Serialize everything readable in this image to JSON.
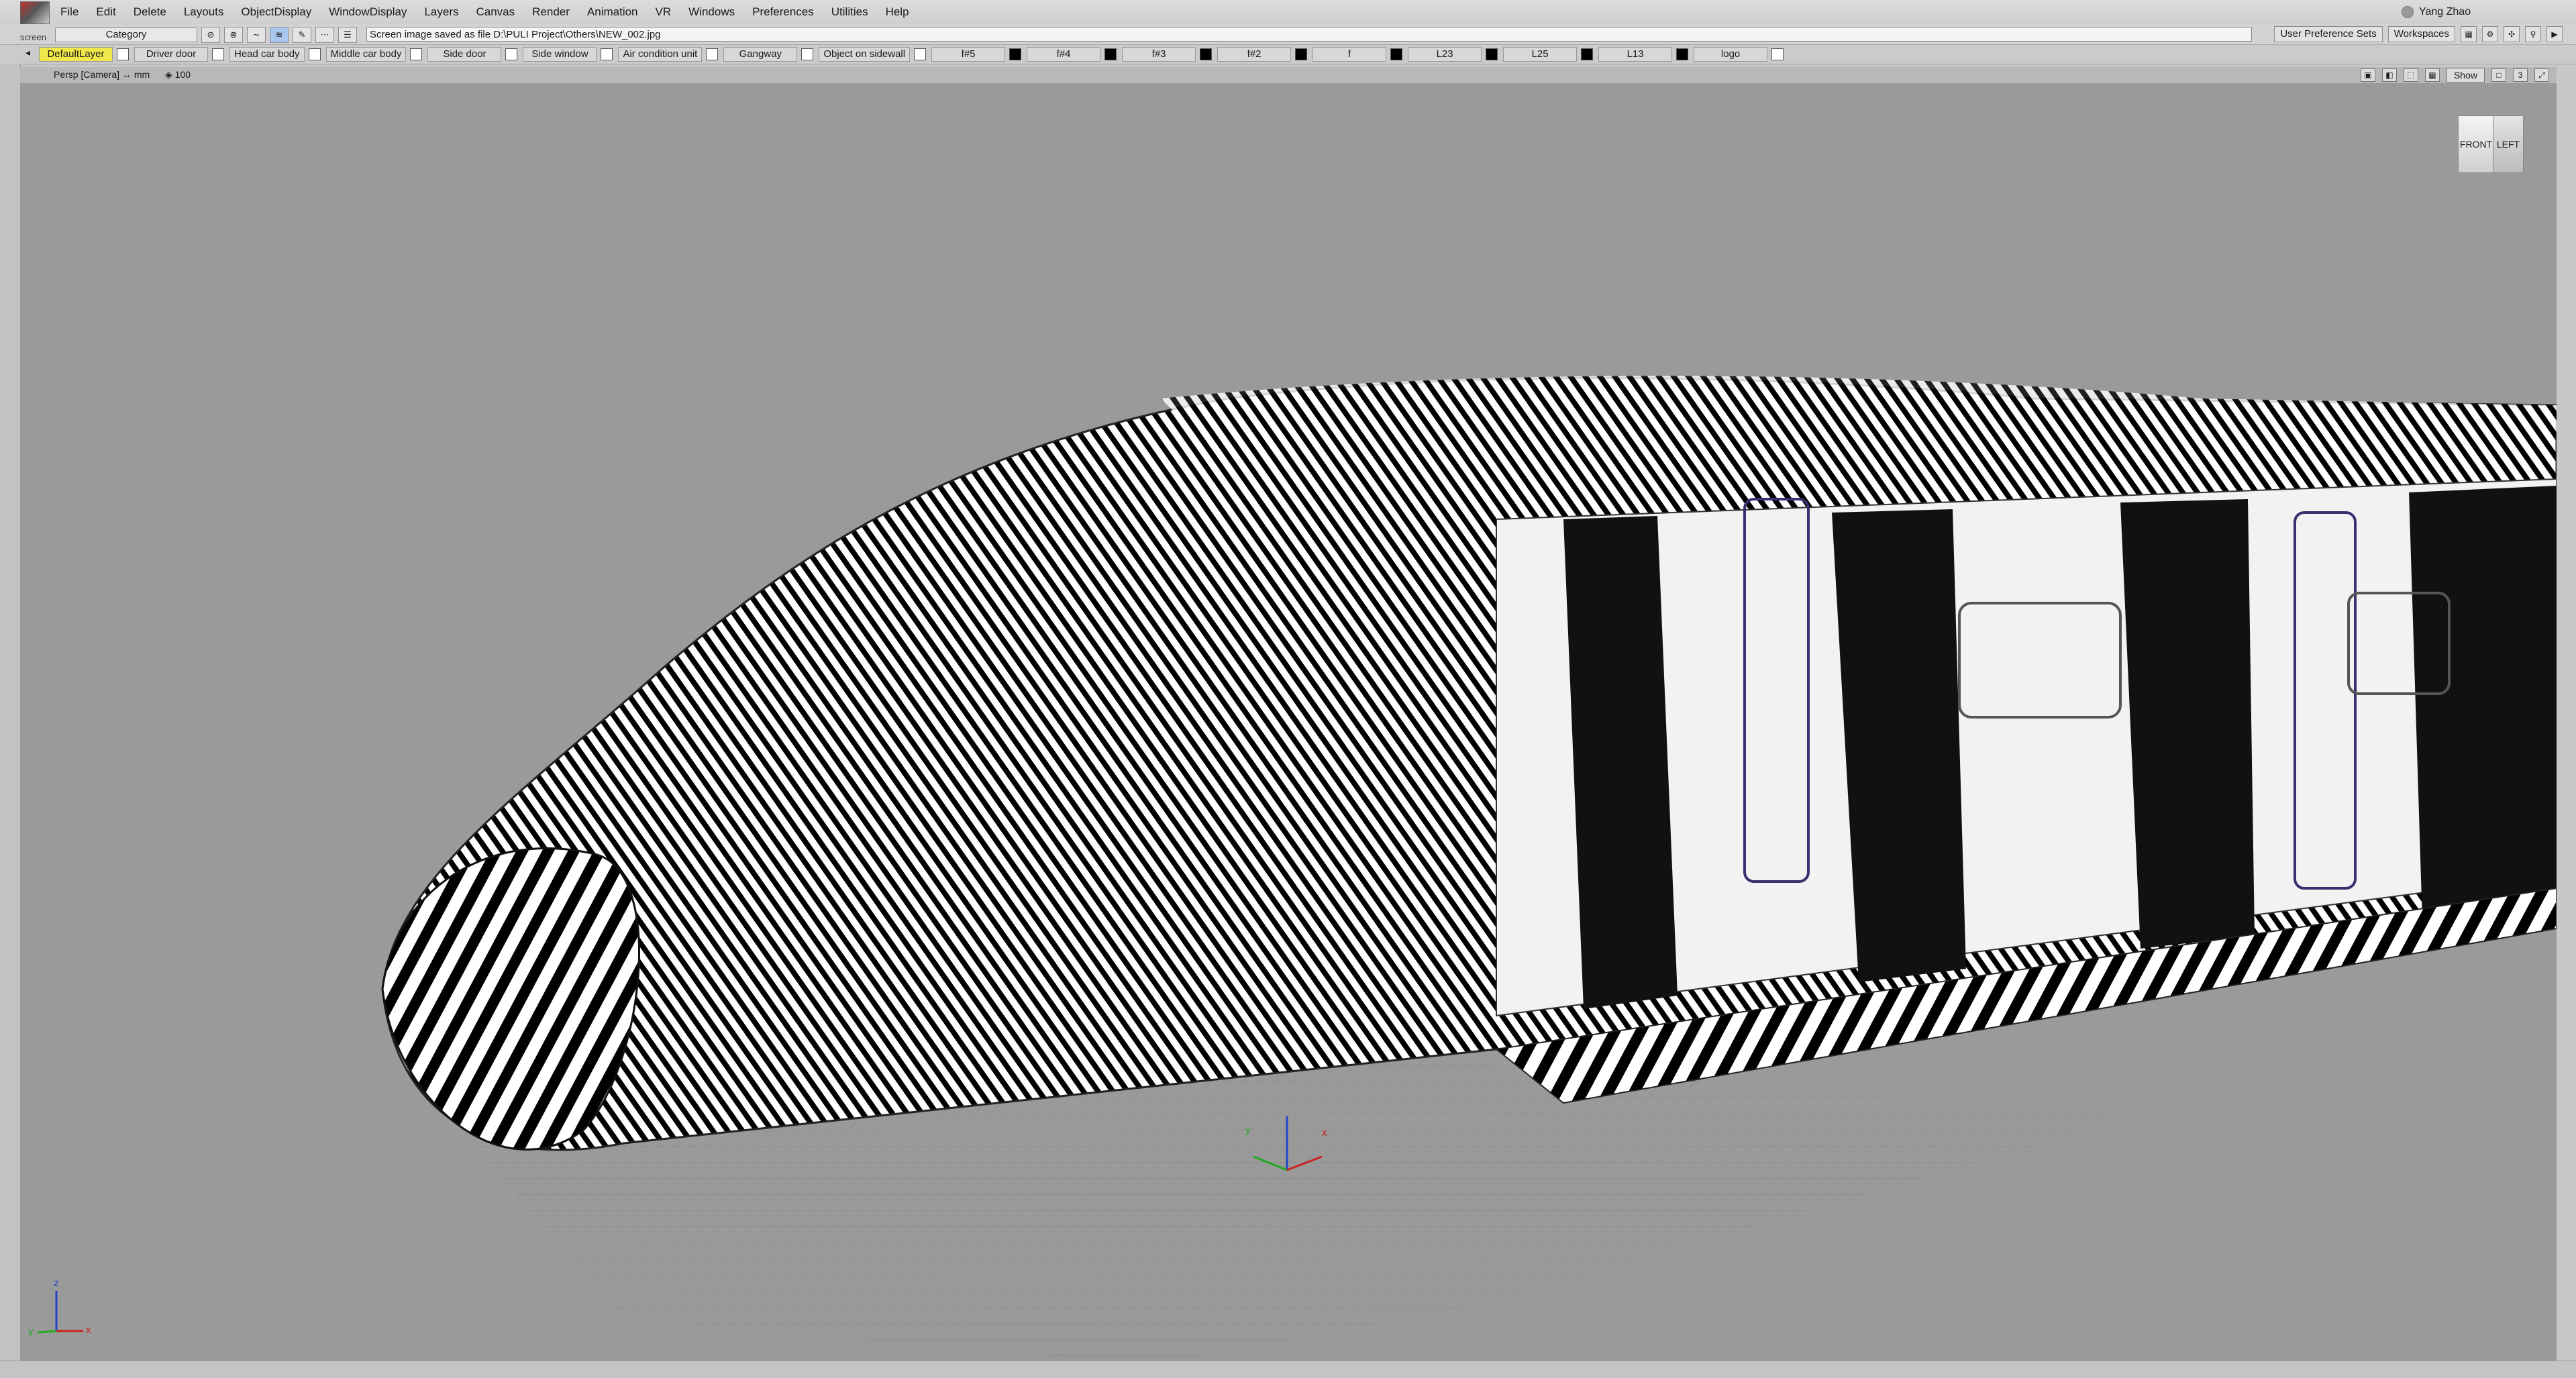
{
  "app": {
    "screen_label": "screen"
  },
  "menu": [
    "File",
    "Edit",
    "Delete",
    "Layouts",
    "ObjectDisplay",
    "WindowDisplay",
    "Layers",
    "Canvas",
    "Render",
    "Animation",
    "VR",
    "Windows",
    "Preferences",
    "Utilities",
    "Help"
  ],
  "user": {
    "name": "Yang Zhao"
  },
  "toolbar": {
    "category": "Category",
    "status_message": "Screen image saved as file D:\\PULI Project\\Others\\NEW_002.jpg",
    "user_preference_sets": "User Preference Sets",
    "workspaces": "Workspaces"
  },
  "layers": [
    {
      "name": "DefaultLayer",
      "active": true,
      "swatch": "white"
    },
    {
      "name": "Driver door",
      "swatch": "white"
    },
    {
      "name": "Head car body",
      "swatch": "white"
    },
    {
      "name": "Middle car body",
      "swatch": "white"
    },
    {
      "name": "Side door",
      "swatch": "white"
    },
    {
      "name": "Side window",
      "swatch": "white"
    },
    {
      "name": "Air condition unit",
      "swatch": "white"
    },
    {
      "name": "Gangway",
      "swatch": "white"
    },
    {
      "name": "Object on sidewall",
      "swatch": "white"
    },
    {
      "name": "f#5",
      "swatch": "black"
    },
    {
      "name": "f#4",
      "swatch": "black"
    },
    {
      "name": "f#3",
      "swatch": "black"
    },
    {
      "name": "f#2",
      "swatch": "black"
    },
    {
      "name": "f",
      "swatch": "black"
    },
    {
      "name": "L23",
      "swatch": "black"
    },
    {
      "name": "L25",
      "swatch": "black"
    },
    {
      "name": "L13",
      "swatch": "black"
    },
    {
      "name": "logo",
      "swatch": "white"
    }
  ],
  "viewport": {
    "camera": "Persp [Camera] ↔ mm",
    "zoom": "100",
    "show_label": "Show",
    "count": "3",
    "viewcube_front": "FRONT",
    "viewcube_left": "LEFT"
  },
  "axes": {
    "x": "x",
    "y": "y",
    "z": "z"
  },
  "colors": {
    "active_layer": "#f0e84a",
    "viewport_bg": "#9a9a9a",
    "axis_x": "#cc2222",
    "axis_y": "#22aa22",
    "axis_z": "#2244cc"
  }
}
